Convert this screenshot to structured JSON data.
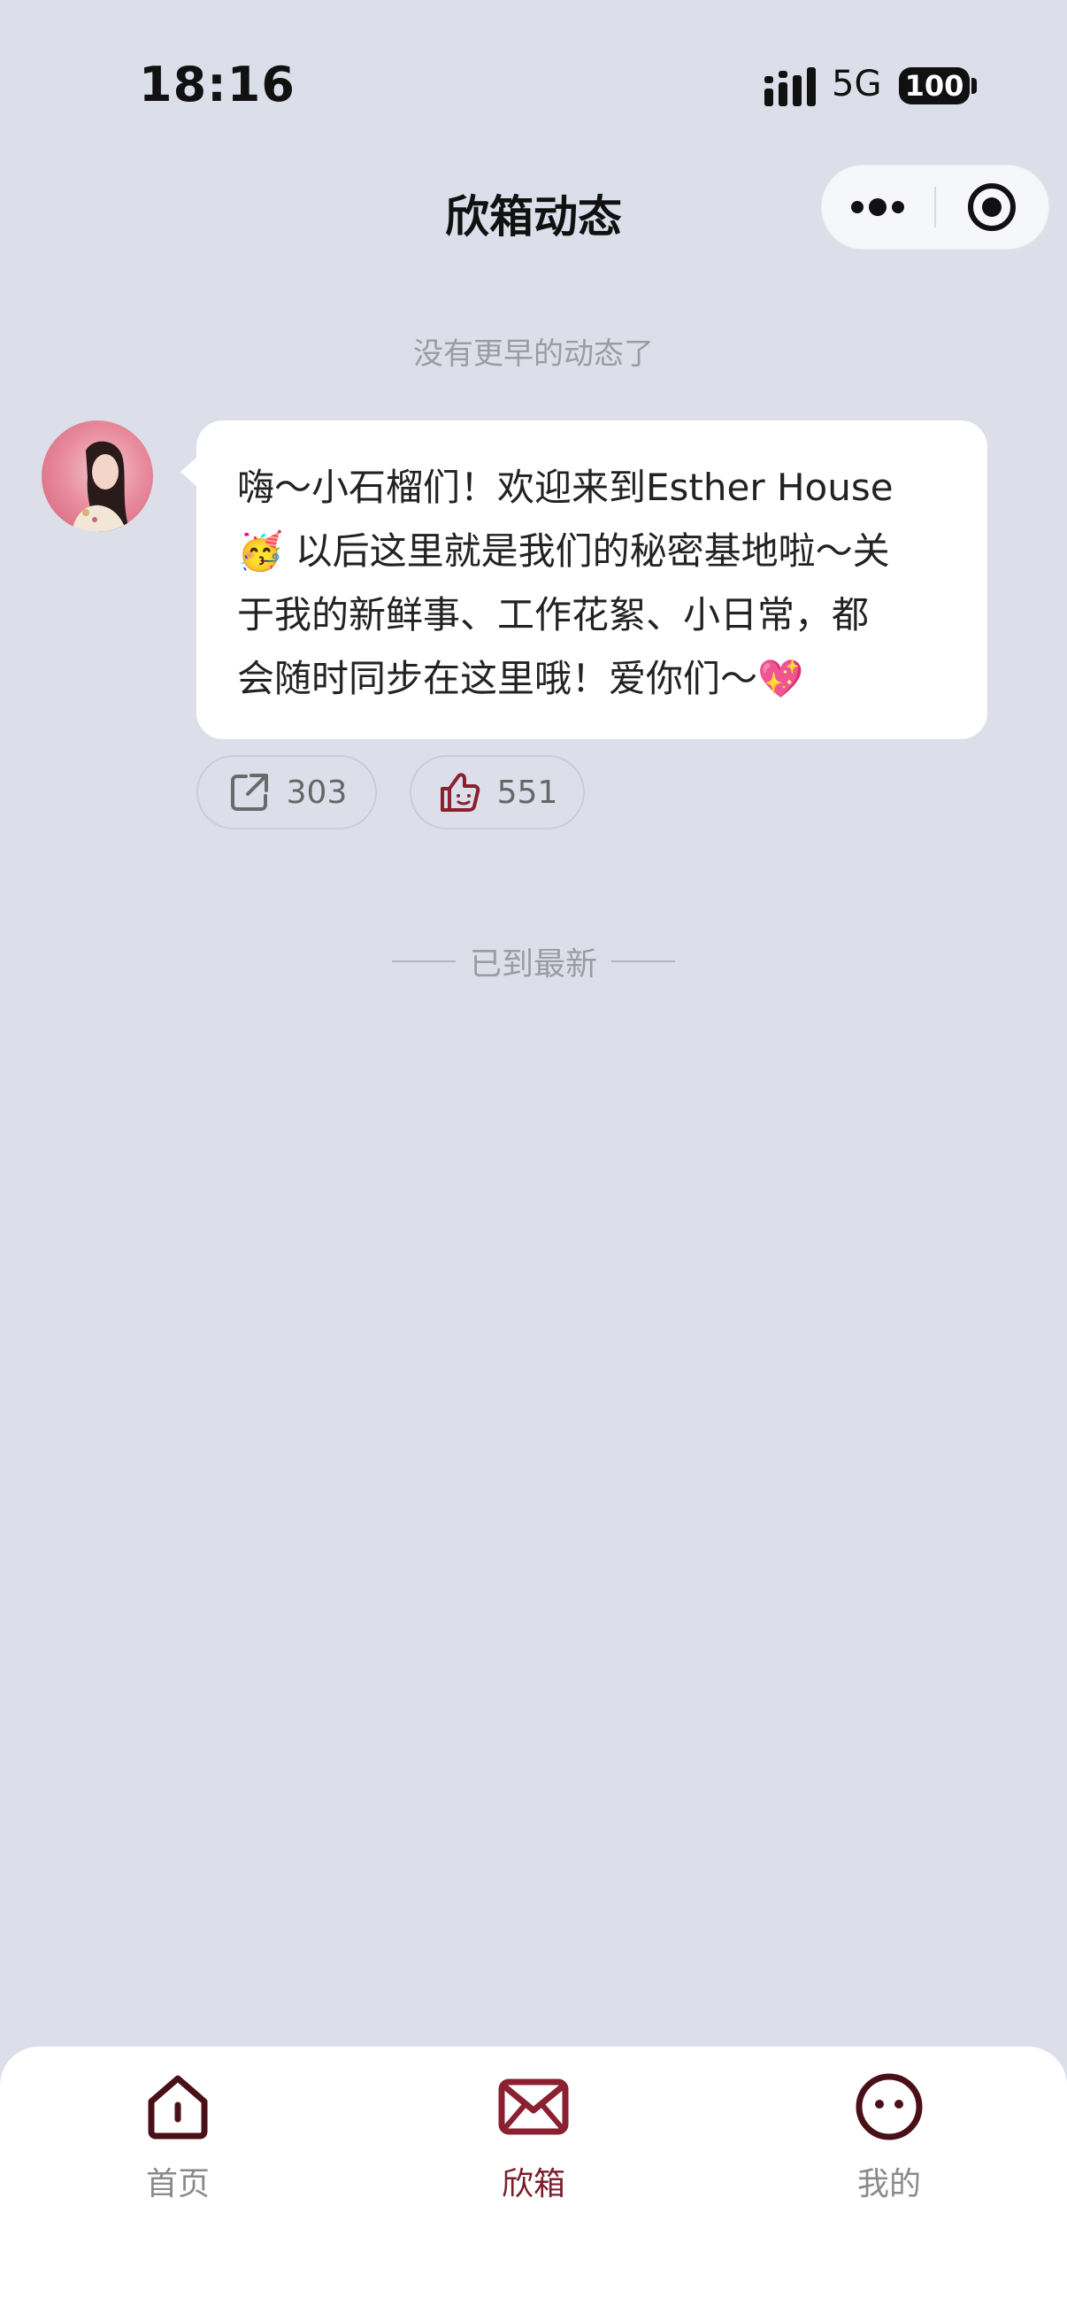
{
  "status_bar": {
    "time": "18:16",
    "network": "5G",
    "battery": "100"
  },
  "nav": {
    "title": "欣箱动态",
    "more_icon": "more-dots-icon",
    "close_icon": "target-close-icon"
  },
  "feed": {
    "top_notice": "没有更早的动态了",
    "post": {
      "avatar_icon": "avatar-portrait",
      "lines": [
        "嗨～小石榴们！欢迎来到Esther House",
        "🥳 以后这里就是我们的秘密基地啦～关",
        "于我的新鲜事、工作花絮、小日常，都",
        "会随时同步在这里哦！爱你们～💖"
      ],
      "share_count": "303",
      "like_count": "551",
      "share_icon": "share-icon",
      "like_icon": "thumbs-up-icon"
    },
    "bottom_notice": "已到最新"
  },
  "tabbar": {
    "tabs": [
      {
        "label": "首页",
        "icon": "home-icon",
        "active": false
      },
      {
        "label": "欣箱",
        "icon": "mail-icon",
        "active": true
      },
      {
        "label": "我的",
        "icon": "profile-face-icon",
        "active": false
      }
    ],
    "colors": {
      "active": "#7a1e2a",
      "inactive": "#8a8a8a"
    }
  },
  "colors": {
    "background": "#dcdfe9",
    "bubble": "#ffffff",
    "accent": "#7a1e2a"
  }
}
